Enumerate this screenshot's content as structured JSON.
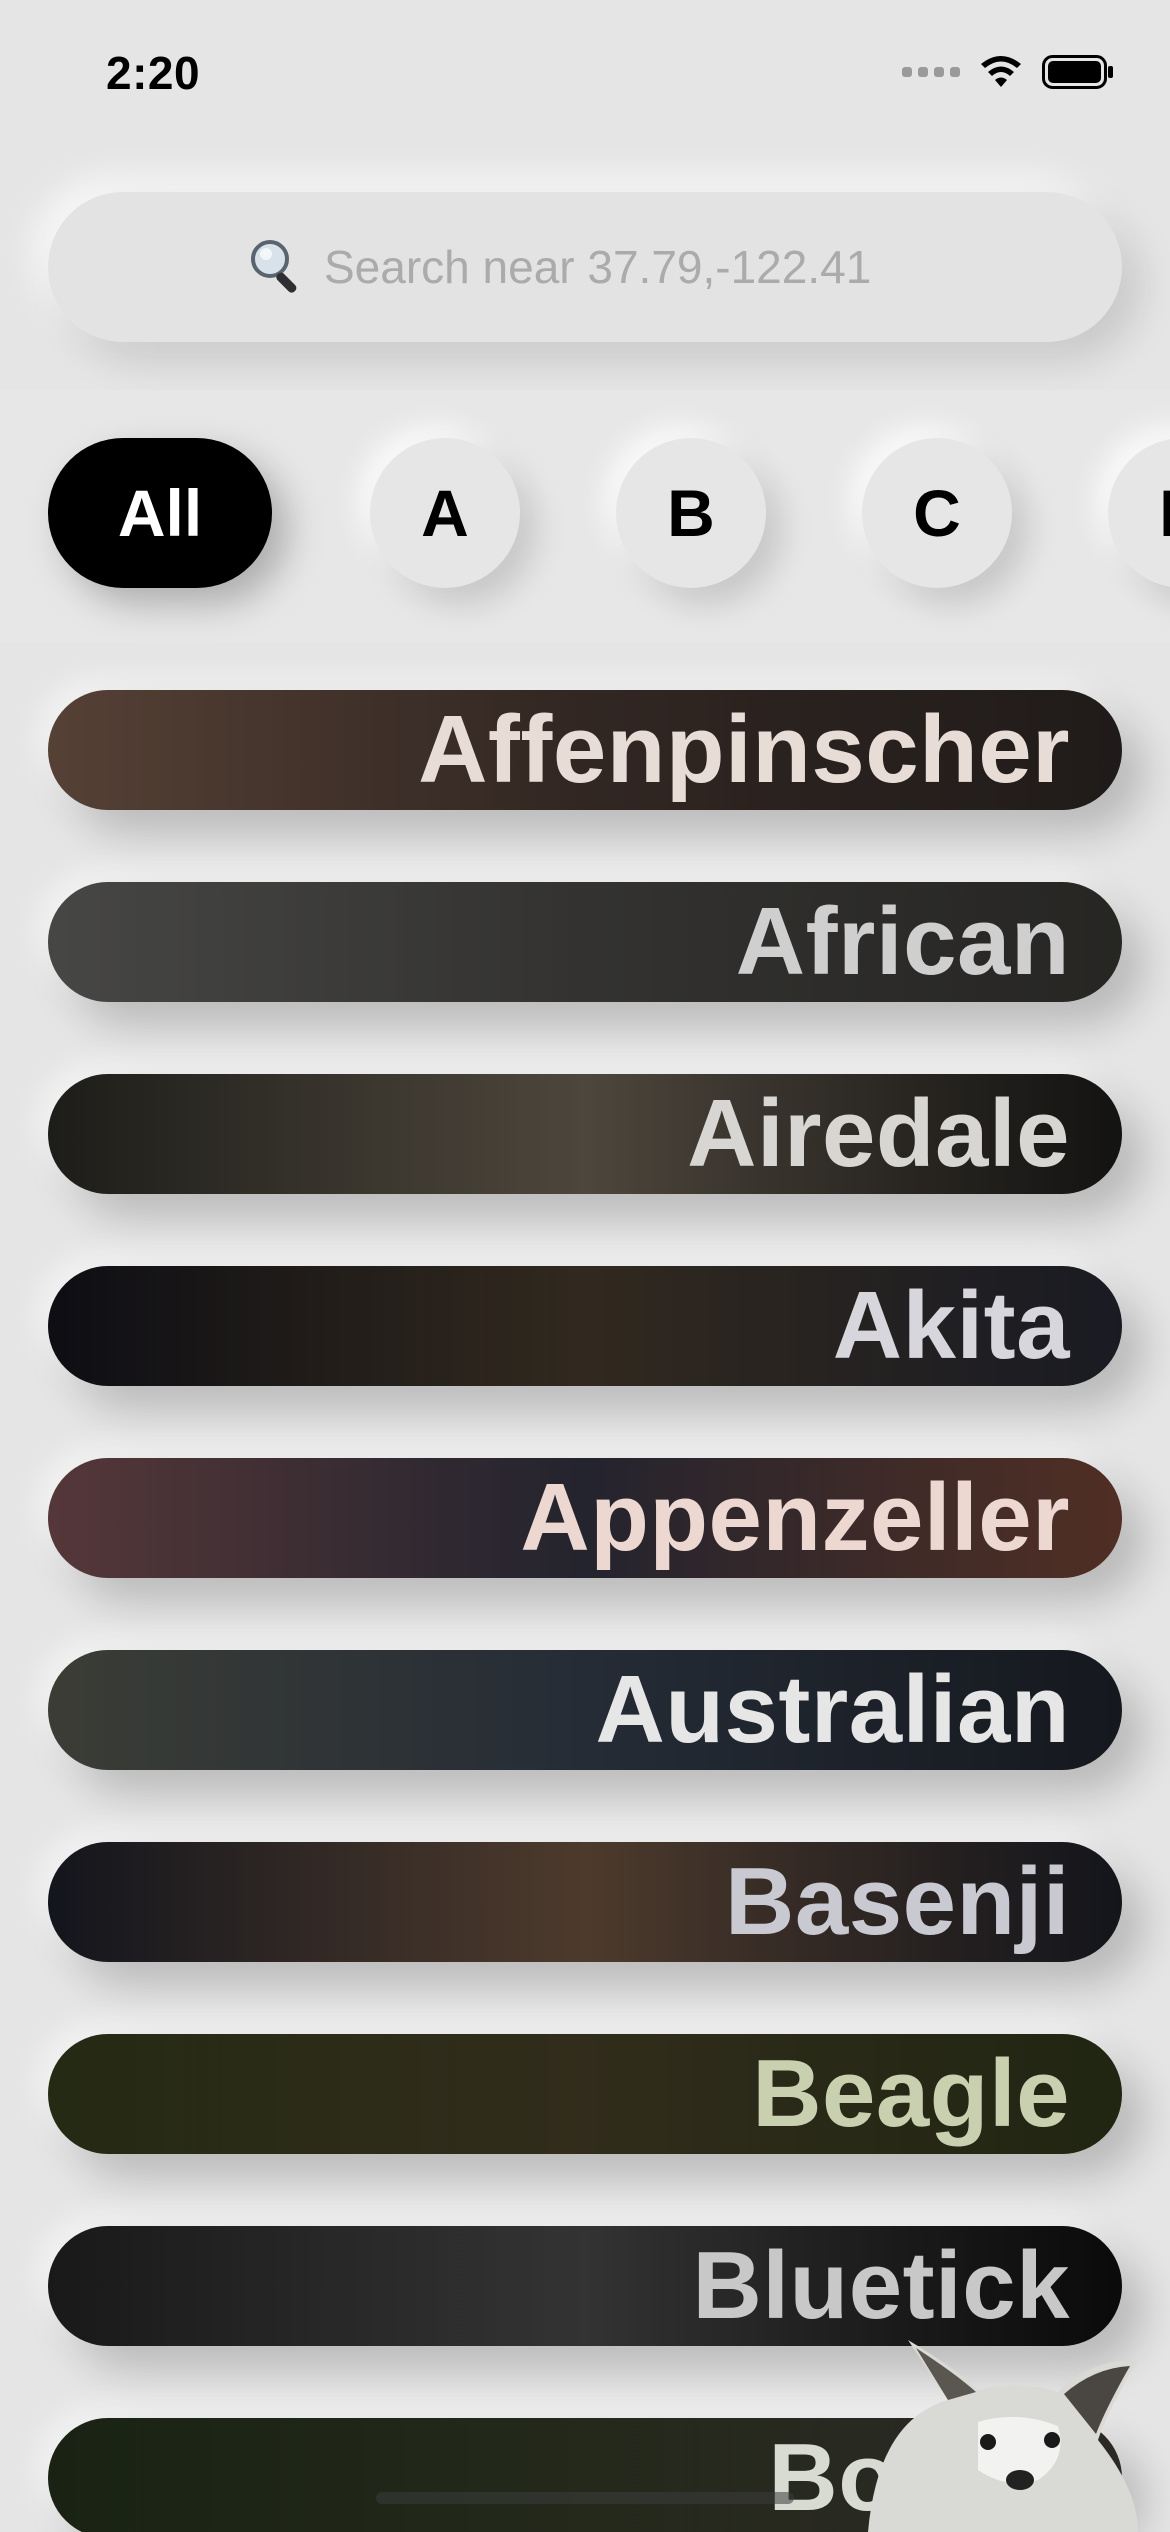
{
  "status_bar": {
    "time": "2:20",
    "icons": [
      "signal-dots-icon",
      "wifi-icon",
      "battery-icon"
    ]
  },
  "search": {
    "placeholder": "Search near 37.79,-122.41",
    "icon": "magnifying-glass-icon"
  },
  "filters": {
    "chips": [
      {
        "label": "All",
        "active": true
      },
      {
        "label": "A",
        "active": false
      },
      {
        "label": "B",
        "active": false
      },
      {
        "label": "C",
        "active": false
      },
      {
        "label": "D",
        "active": false
      }
    ]
  },
  "breeds": [
    {
      "name": "Affenpinscher",
      "text_color": "#e8ddd6",
      "bg_colors": [
        "#5a4438",
        "#3a2d28",
        "#2a2422"
      ]
    },
    {
      "name": "African",
      "text_color": "#cfcfcf",
      "bg_colors": [
        "#4a4a48",
        "#3c3b39",
        "#33322f"
      ]
    },
    {
      "name": "Airedale",
      "text_color": "#d8d6d2",
      "bg_colors": [
        "#1e1e1a",
        "#5a5246",
        "#1a1918"
      ]
    },
    {
      "name": "Akita",
      "text_color": "#d6d6dc",
      "bg_colors": [
        "#0e0e14",
        "#3a3024",
        "#22242e"
      ]
    },
    {
      "name": "Appenzeller",
      "text_color": "#ecd8d0",
      "bg_colors": [
        "#5a3a3c",
        "#2a2a36",
        "#6a3e30"
      ]
    },
    {
      "name": "Australian",
      "text_color": "#e6e6e6",
      "bg_colors": [
        "#3e4038",
        "#2c3440",
        "#1c2028"
      ]
    },
    {
      "name": "Basenji",
      "text_color": "#c9c9d2",
      "bg_colors": [
        "#14161e",
        "#5a4434",
        "#1a1c24"
      ]
    },
    {
      "name": "Beagle",
      "text_color": "#c9d0b0",
      "bg_colors": [
        "#262c14",
        "#3a3420",
        "#2a3218"
      ]
    },
    {
      "name": "Bluetick",
      "text_color": "#c8c8c8",
      "bg_colors": [
        "#1a1a1a",
        "#3c3c3c",
        "#0e0e0e"
      ]
    },
    {
      "name": "Borzoi",
      "text_color": "#d8dbd2",
      "bg_colors": [
        "#1a2414",
        "#2a3020",
        "#3a3630"
      ]
    }
  ]
}
